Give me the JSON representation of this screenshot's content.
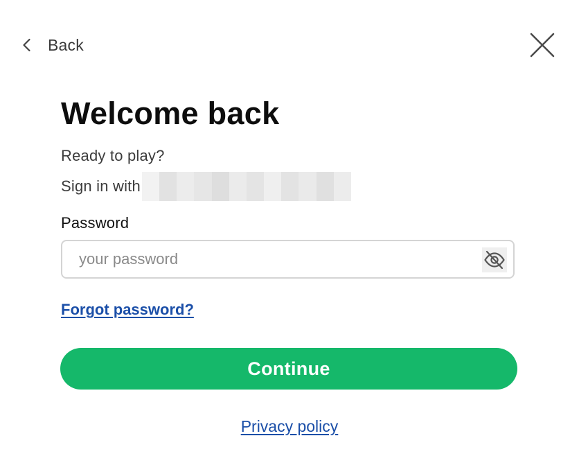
{
  "nav": {
    "back_label": "Back",
    "back_icon": "chevron-left-icon",
    "close_icon": "close-icon"
  },
  "header": {
    "title": "Welcome back",
    "subtitle": "Ready to play?",
    "signin_prefix": "Sign in with"
  },
  "form": {
    "password_label": "Password",
    "password_value": "",
    "password_placeholder": "your password",
    "visibility_icon": "eye-off-icon",
    "forgot_link": "Forgot password?",
    "continue_label": "Continue"
  },
  "footer": {
    "privacy_link": "Privacy policy"
  },
  "colors": {
    "primary_button": "#15b86a",
    "link": "#1b4fa8",
    "field_border": "#d4d4d4"
  }
}
